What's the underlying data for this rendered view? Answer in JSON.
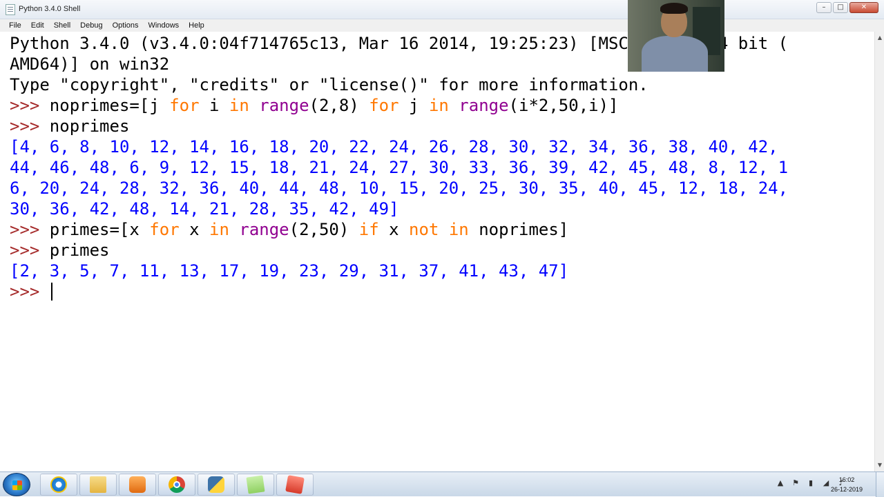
{
  "window": {
    "title": "Python 3.4.0 Shell",
    "controls": [
      "–",
      "□",
      "✕"
    ]
  },
  "menu": [
    "File",
    "Edit",
    "Shell",
    "Debug",
    "Options",
    "Windows",
    "Help"
  ],
  "shell": {
    "banner1": "Python 3.4.0 (v3.4.0:04f714765c13, Mar 16 2014, 19:25:23) [MSC v.1600 64 bit (",
    "banner2": "AMD64)] on win32",
    "banner3": "Type \"copyright\", \"credits\" or \"license()\" for more information.",
    "prompt": ">>> ",
    "cmd1": {
      "a": "noprimes=[j ",
      "b": "for",
      "c": " i ",
      "d": "in",
      "e": " ",
      "f": "range",
      "g": "(2,8) ",
      "h": "for",
      "i": " j ",
      "j": "in",
      "k": " ",
      "l": "range",
      "m": "(i*2,50,i)]"
    },
    "cmd2": "noprimes",
    "out1": [
      "[4, 6, 8, 10, 12, 14, 16, 18, 20, 22, 24, 26, 28, 30, 32, 34, 36, 38, 40, 42,",
      "44, 46, 48, 6, 9, 12, 15, 18, 21, 24, 27, 30, 33, 36, 39, 42, 45, 48, 8, 12, 1",
      "6, 20, 24, 28, 32, 36, 40, 44, 48, 10, 15, 20, 25, 30, 35, 40, 45, 12, 18, 24,",
      "30, 36, 42, 48, 14, 21, 28, 35, 42, 49]"
    ],
    "cmd3": {
      "a": "primes=[x ",
      "b": "for",
      "c": " x ",
      "d": "in",
      "e": " ",
      "f": "range",
      "g": "(2,50) ",
      "h": "if",
      "i": " x ",
      "j": "not in",
      "k": " noprimes]"
    },
    "cmd4": "primes",
    "out2": "[2, 3, 5, 7, 11, 13, 17, 19, 23, 29, 31, 37, 41, 43, 47]"
  },
  "taskbar": {
    "apps": [
      "internet-explorer-icon",
      "file-explorer-icon",
      "media-player-icon",
      "chrome-icon",
      "python-idle-icon",
      "sticky-notes-icon",
      "snipping-tool-icon"
    ],
    "tray_icons": [
      "▲",
      "⚑",
      "▮",
      "◢",
      "♪"
    ],
    "time": "16:02",
    "date": "26-12-2019"
  }
}
